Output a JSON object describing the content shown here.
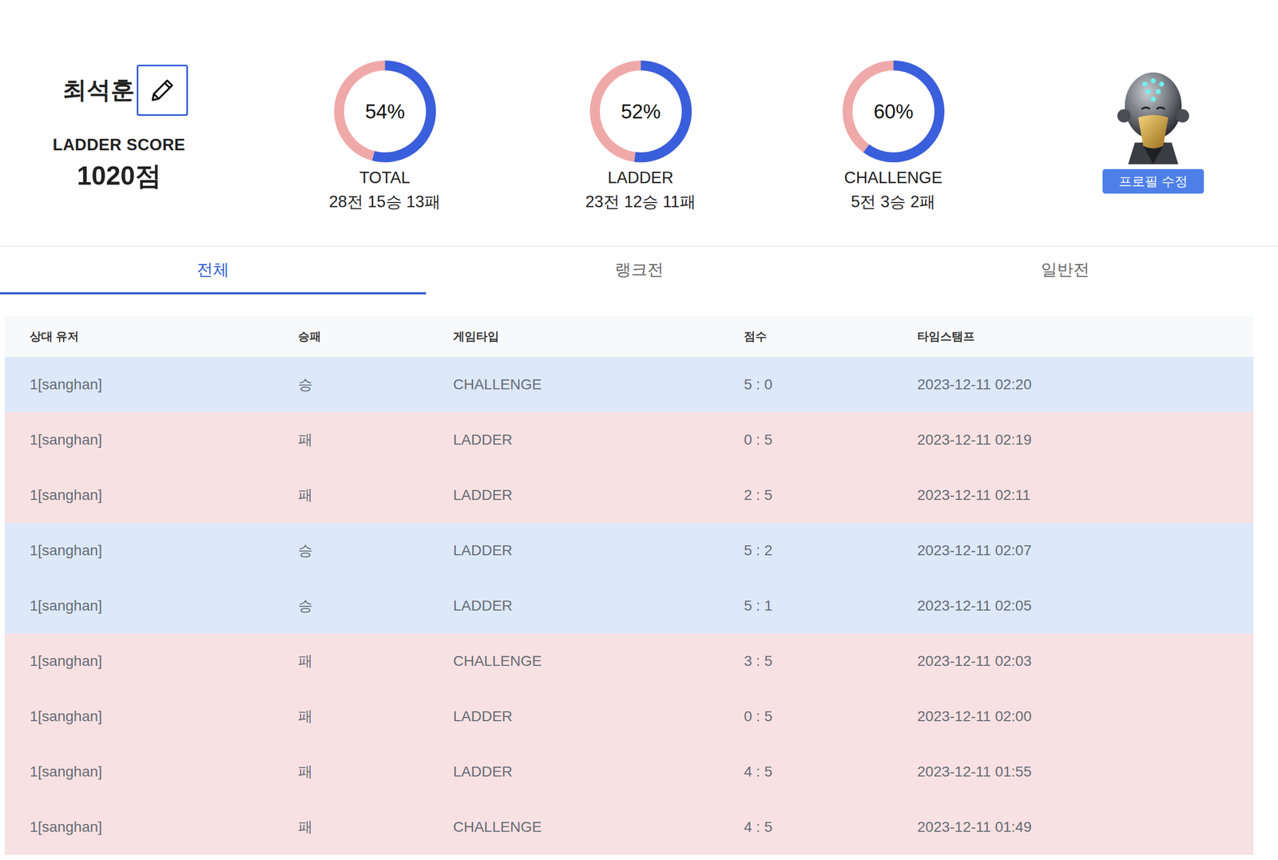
{
  "profile": {
    "name": "최석훈",
    "score_label": "LADDER SCORE",
    "score": "1020점",
    "edit_button": "프로필 수정"
  },
  "stats": [
    {
      "percent": "54%",
      "label": "TOTAL",
      "record": "28전 15승 13패",
      "level": 0.54
    },
    {
      "percent": "52%",
      "label": "LADDER",
      "record": "23전 12승 11패",
      "level": 0.52
    },
    {
      "percent": "60%",
      "label": "CHALLENGE",
      "record": "5전 3승 2패",
      "level": 0.6
    }
  ],
  "tabs": [
    {
      "label": "전체",
      "selected": true
    },
    {
      "label": "랭크전",
      "selected": false
    },
    {
      "label": "일반전",
      "selected": false
    }
  ],
  "table": {
    "columns": [
      "상대 유저",
      "승패",
      "게임타입",
      "점수",
      "타임스탬프"
    ],
    "rows": [
      {
        "opponent": "1[sanghan]",
        "result": "승",
        "type": "CHALLENGE",
        "score": "5 : 0",
        "time": "2023-12-11 02:20",
        "win": true
      },
      {
        "opponent": "1[sanghan]",
        "result": "패",
        "type": "LADDER",
        "score": "0 : 5",
        "time": "2023-12-11 02:19",
        "win": false
      },
      {
        "opponent": "1[sanghan]",
        "result": "패",
        "type": "LADDER",
        "score": "2 : 5",
        "time": "2023-12-11 02:11",
        "win": false
      },
      {
        "opponent": "1[sanghan]",
        "result": "승",
        "type": "LADDER",
        "score": "5 : 2",
        "time": "2023-12-11 02:07",
        "win": true
      },
      {
        "opponent": "1[sanghan]",
        "result": "승",
        "type": "LADDER",
        "score": "5 : 1",
        "time": "2023-12-11 02:05",
        "win": true
      },
      {
        "opponent": "1[sanghan]",
        "result": "패",
        "type": "CHALLENGE",
        "score": "3 : 5",
        "time": "2023-12-11 02:03",
        "win": false
      },
      {
        "opponent": "1[sanghan]",
        "result": "패",
        "type": "LADDER",
        "score": "0 : 5",
        "time": "2023-12-11 02:00",
        "win": false
      },
      {
        "opponent": "1[sanghan]",
        "result": "패",
        "type": "LADDER",
        "score": "4 : 5",
        "time": "2023-12-11 01:55",
        "win": false
      },
      {
        "opponent": "1[sanghan]",
        "result": "패",
        "type": "CHALLENGE",
        "score": "4 : 5",
        "time": "2023-12-11 01:49",
        "win": false
      }
    ]
  }
}
